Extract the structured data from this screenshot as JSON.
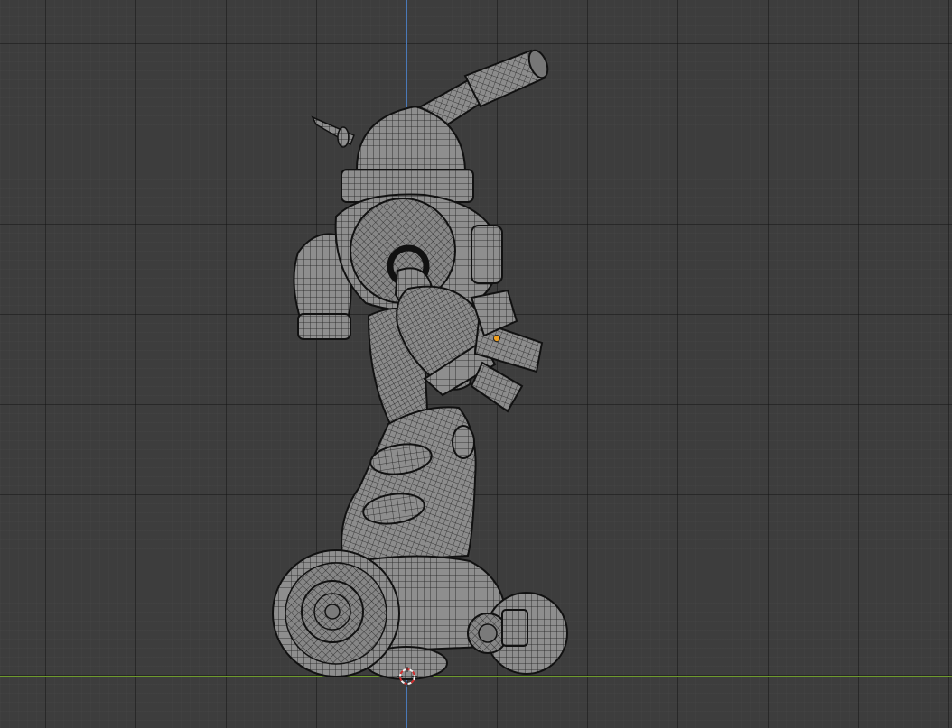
{
  "viewport": {
    "background_color": "#3d3d3d",
    "grid_major_color": "#2a2a2a",
    "grid_minor_color": "#464646",
    "axis_z_color": "#4a79b8",
    "axis_y_color": "#6e9a2e"
  },
  "model": {
    "mode": "wireframe",
    "mesh_color": "#8a8a8a",
    "wire_color": "#1a1a1a",
    "origin_color": "#f0a020"
  },
  "cursor3d": {
    "icon": "3d-cursor-icon",
    "colors": [
      "#d03030",
      "#f2f2f2"
    ]
  }
}
